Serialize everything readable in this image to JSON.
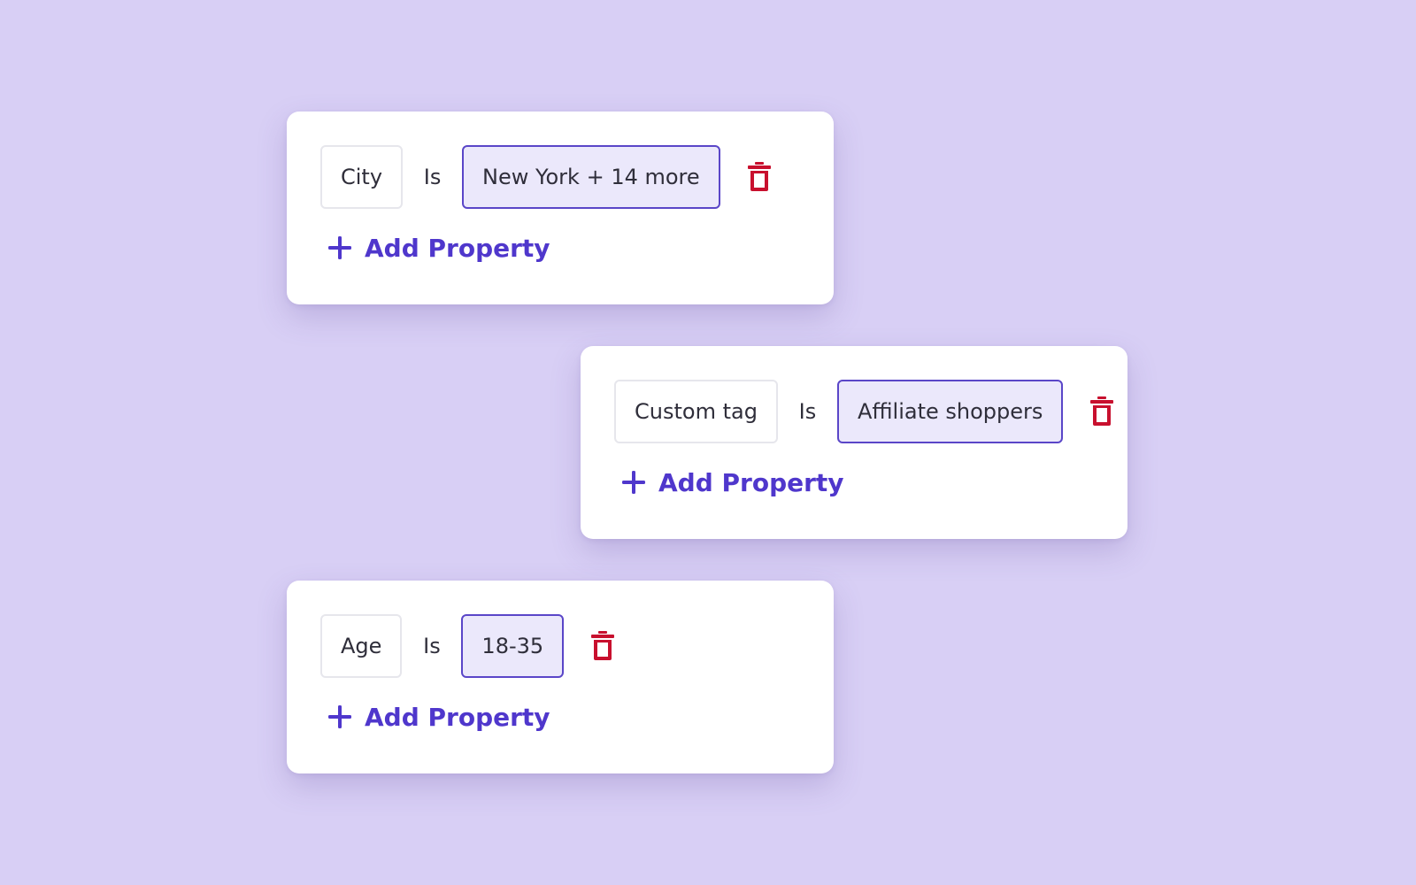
{
  "theme": {
    "background": "#d8cff5",
    "accent": "#4f37cc",
    "value_fill": "#ebe8fb",
    "danger": "#c8102e"
  },
  "filters": [
    {
      "property": "City",
      "operator": "Is",
      "value": "New York + 14 more",
      "delete_icon": "trash-icon",
      "add_label": "Add Property",
      "add_icon": "plus-icon"
    },
    {
      "property": "Custom tag",
      "operator": "Is",
      "value": "Affiliate shoppers",
      "delete_icon": "trash-icon",
      "add_label": "Add Property",
      "add_icon": "plus-icon"
    },
    {
      "property": "Age",
      "operator": "Is",
      "value": "18-35",
      "delete_icon": "trash-icon",
      "add_label": "Add Property",
      "add_icon": "plus-icon"
    }
  ]
}
